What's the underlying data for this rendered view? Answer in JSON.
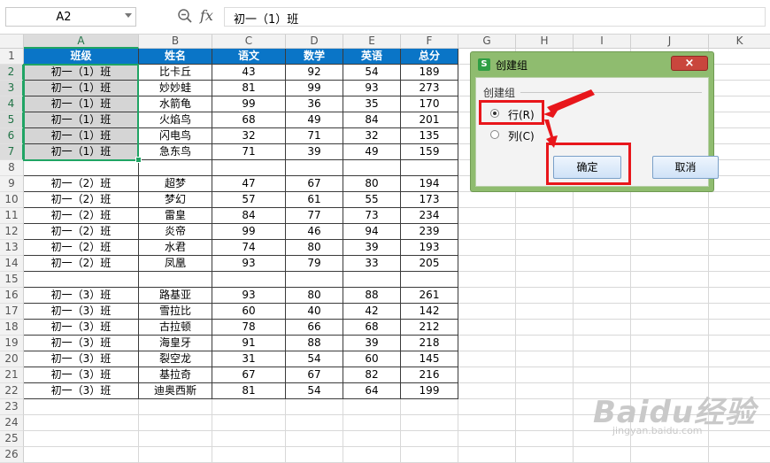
{
  "formula_bar": {
    "cell_ref": "A2",
    "fx_label": "fx",
    "formula": "初一（1）班"
  },
  "columns": [
    "A",
    "B",
    "C",
    "D",
    "E",
    "F",
    "G",
    "H",
    "I",
    "J",
    "K"
  ],
  "selected_column": "A",
  "rows": [
    {
      "n": "1",
      "cells": [
        "班级",
        "姓名",
        "语文",
        "数学",
        "英语",
        "总分"
      ]
    },
    {
      "n": "2",
      "cells": [
        "初一（1）班",
        "比卡丘",
        "43",
        "92",
        "54",
        "189"
      ]
    },
    {
      "n": "3",
      "cells": [
        "初一（1）班",
        "妙妙蛙",
        "81",
        "99",
        "93",
        "273"
      ]
    },
    {
      "n": "4",
      "cells": [
        "初一（1）班",
        "水箭龟",
        "99",
        "36",
        "35",
        "170"
      ]
    },
    {
      "n": "5",
      "cells": [
        "初一（1）班",
        "火焰鸟",
        "68",
        "49",
        "84",
        "201"
      ]
    },
    {
      "n": "6",
      "cells": [
        "初一（1）班",
        "闪电鸟",
        "32",
        "71",
        "32",
        "135"
      ]
    },
    {
      "n": "7",
      "cells": [
        "初一（1）班",
        "急东鸟",
        "71",
        "39",
        "49",
        "159"
      ]
    },
    {
      "n": "8",
      "cells": [
        "",
        "",
        "",
        "",
        "",
        ""
      ]
    },
    {
      "n": "9",
      "cells": [
        "初一（2）班",
        "超梦",
        "47",
        "67",
        "80",
        "194"
      ]
    },
    {
      "n": "10",
      "cells": [
        "初一（2）班",
        "梦幻",
        "57",
        "61",
        "55",
        "173"
      ]
    },
    {
      "n": "11",
      "cells": [
        "初一（2）班",
        "雷皇",
        "84",
        "77",
        "73",
        "234"
      ]
    },
    {
      "n": "12",
      "cells": [
        "初一（2）班",
        "炎帝",
        "99",
        "46",
        "94",
        "239"
      ]
    },
    {
      "n": "13",
      "cells": [
        "初一（2）班",
        "水君",
        "74",
        "80",
        "39",
        "193"
      ]
    },
    {
      "n": "14",
      "cells": [
        "初一（2）班",
        "凤凰",
        "93",
        "79",
        "33",
        "205"
      ]
    },
    {
      "n": "15",
      "cells": [
        "",
        "",
        "",
        "",
        "",
        ""
      ]
    },
    {
      "n": "16",
      "cells": [
        "初一（3）班",
        "路基亚",
        "93",
        "80",
        "88",
        "261"
      ]
    },
    {
      "n": "17",
      "cells": [
        "初一（3）班",
        "雪拉比",
        "60",
        "40",
        "42",
        "142"
      ]
    },
    {
      "n": "18",
      "cells": [
        "初一（3）班",
        "古拉顿",
        "78",
        "66",
        "68",
        "212"
      ]
    },
    {
      "n": "19",
      "cells": [
        "初一（3）班",
        "海皇牙",
        "91",
        "88",
        "39",
        "218"
      ]
    },
    {
      "n": "20",
      "cells": [
        "初一（3）班",
        "裂空龙",
        "31",
        "54",
        "60",
        "145"
      ]
    },
    {
      "n": "21",
      "cells": [
        "初一（3）班",
        "基拉奇",
        "67",
        "67",
        "82",
        "216"
      ]
    },
    {
      "n": "22",
      "cells": [
        "初一（3）班",
        "迪奥西斯",
        "81",
        "54",
        "64",
        "199"
      ]
    },
    {
      "n": "23",
      "cells": [
        "",
        "",
        "",
        "",
        "",
        ""
      ]
    },
    {
      "n": "24",
      "cells": [
        "",
        "",
        "",
        "",
        "",
        ""
      ]
    },
    {
      "n": "25",
      "cells": [
        "",
        "",
        "",
        "",
        "",
        ""
      ]
    },
    {
      "n": "26",
      "cells": [
        "",
        "",
        "",
        "",
        "",
        ""
      ]
    }
  ],
  "dialog": {
    "title": "创建组",
    "close_label": "×",
    "group_label": "创建组",
    "option_row": "行(R)",
    "option_col": "列(C)",
    "selected_option": "row",
    "ok_label": "确定",
    "cancel_label": "取消",
    "logo_glyph": "S"
  },
  "watermark": {
    "brand": "Baidu经验",
    "url": "jingyan.baidu.com"
  },
  "colors": {
    "header_fill": "#0a75c7",
    "selection": "#20a464",
    "annotation": "#e8161b",
    "dialog_frame": "#8fbc6f"
  }
}
